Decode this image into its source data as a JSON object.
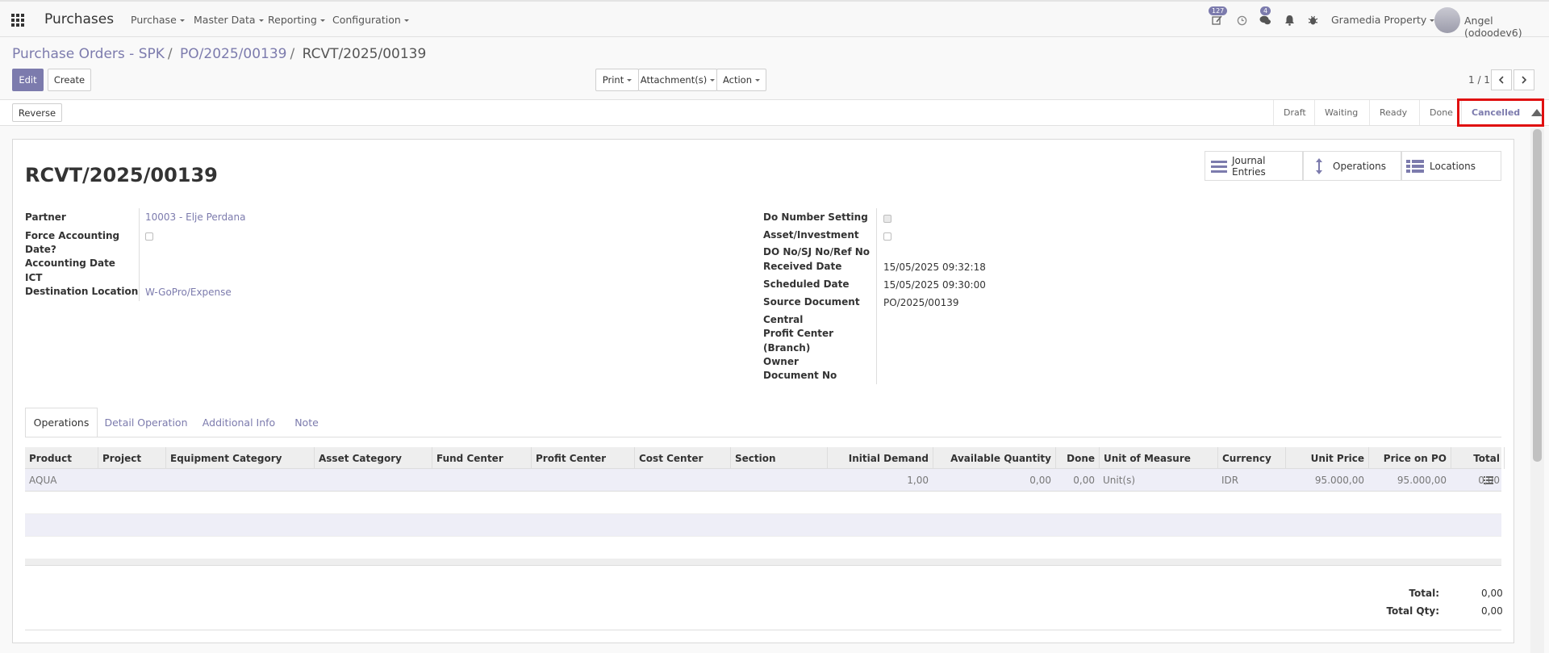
{
  "app": {
    "name": "Purchases"
  },
  "nav": {
    "menus": [
      "Purchase",
      "Master Data",
      "Reporting",
      "Configuration"
    ],
    "activities_badge": "127",
    "messages_badge": "4",
    "company": "Gramedia Property",
    "user": "Angel (odoodev6)"
  },
  "breadcrumb": {
    "level1": "Purchase Orders - SPK",
    "level2": "PO/2025/00139",
    "current": "RCVT/2025/00139",
    "sep": "/"
  },
  "toolbar": {
    "edit": "Edit",
    "create": "Create",
    "print": "Print",
    "attachments": "Attachment(s)",
    "action": "Action",
    "pager": "1 / 1"
  },
  "statusbar": {
    "reverse": "Reverse",
    "stages": [
      "Draft",
      "Waiting",
      "Ready",
      "Done",
      "Cancelled"
    ],
    "active_stage": "Cancelled"
  },
  "smart_buttons": [
    "Journal Entries",
    "Operations",
    "Locations"
  ],
  "record": {
    "title": "RCVT/2025/00139",
    "left": {
      "partner_label": "Partner",
      "partner_value": "10003 - Elje Perdana",
      "force_label_1": "Force Accounting",
      "force_label_2": "Date?",
      "accounting_date_label": "Accounting Date",
      "ict_label": "ICT",
      "dest_label": "Destination Location",
      "dest_value": "W-GoPro/Expense"
    },
    "right": {
      "do_setting_label": "Do Number Setting",
      "asset_label": "Asset/Investment",
      "do_no_label": "DO No/SJ No/Ref No",
      "received_label": "Received Date",
      "received_value": "15/05/2025 09:32:18",
      "scheduled_label": "Scheduled Date",
      "scheduled_value": "15/05/2025 09:30:00",
      "source_label": "Source Document",
      "source_value": "PO/2025/00139",
      "central_label": "Central",
      "profit_label_1": "Profit Center",
      "profit_label_2": "(Branch)",
      "owner_label": "Owner",
      "docno_label": "Document No"
    }
  },
  "tabs": [
    "Operations",
    "Detail Operation",
    "Additional Info",
    "Note"
  ],
  "table": {
    "columns": [
      "Product",
      "Project",
      "Equipment Category",
      "Asset Category",
      "Fund Center",
      "Profit Center",
      "Cost Center",
      "Section",
      "Initial Demand",
      "Available Quantity",
      "Done",
      "Unit of Measure",
      "Currency",
      "Unit Price",
      "Price on PO",
      "Total"
    ],
    "rows": [
      [
        "AQUA",
        "",
        "",
        "",
        "",
        "",
        "",
        "",
        "1,00",
        "0,00",
        "0,00",
        "Unit(s)",
        "IDR",
        "95.000,00",
        "95.000,00",
        "0,00"
      ]
    ]
  },
  "totals": {
    "total_label": "Total:",
    "total_value": "0,00",
    "qty_label": "Total Qty:",
    "qty_value": "0,00"
  }
}
